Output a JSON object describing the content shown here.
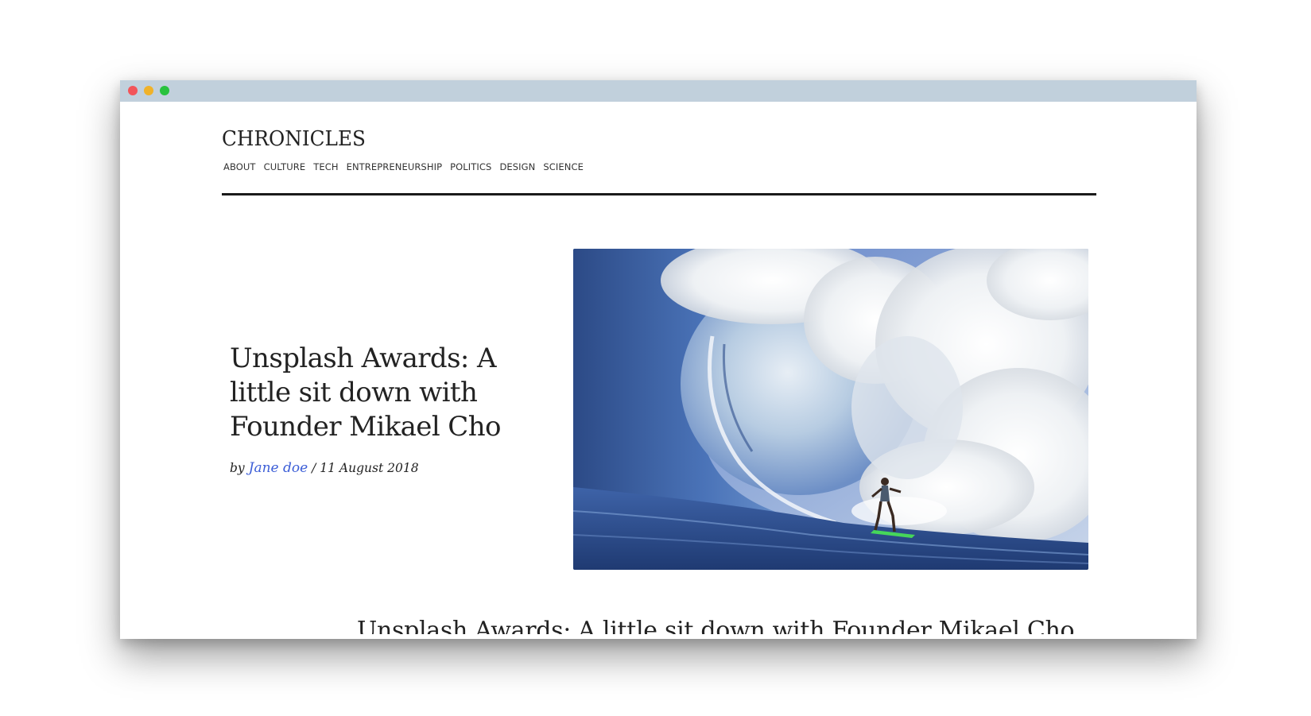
{
  "window": {
    "controls": [
      "close",
      "minimize",
      "maximize"
    ],
    "titlebar_color": "#c1d0dc"
  },
  "site": {
    "logo": "CHRONICLES"
  },
  "nav": {
    "items": [
      "ABOUT",
      "CULTURE",
      "TECH",
      "ENTREPRENEURSHIP",
      "POLITICS",
      "DESIGN",
      "SCIENCE"
    ]
  },
  "article": {
    "title": "Unsplash Awards: A little sit down with Founder Mikael Cho",
    "by_prefix": "by",
    "author": "Jane doe",
    "separator": "/",
    "date": "11 August 2018",
    "author_link_color": "#3c5ed7",
    "hero_image": "surfer riding a large blue ocean wave"
  },
  "cutoff": {
    "text": "Unsplash Awards: A little sit down with Founder Mikael Cho"
  }
}
